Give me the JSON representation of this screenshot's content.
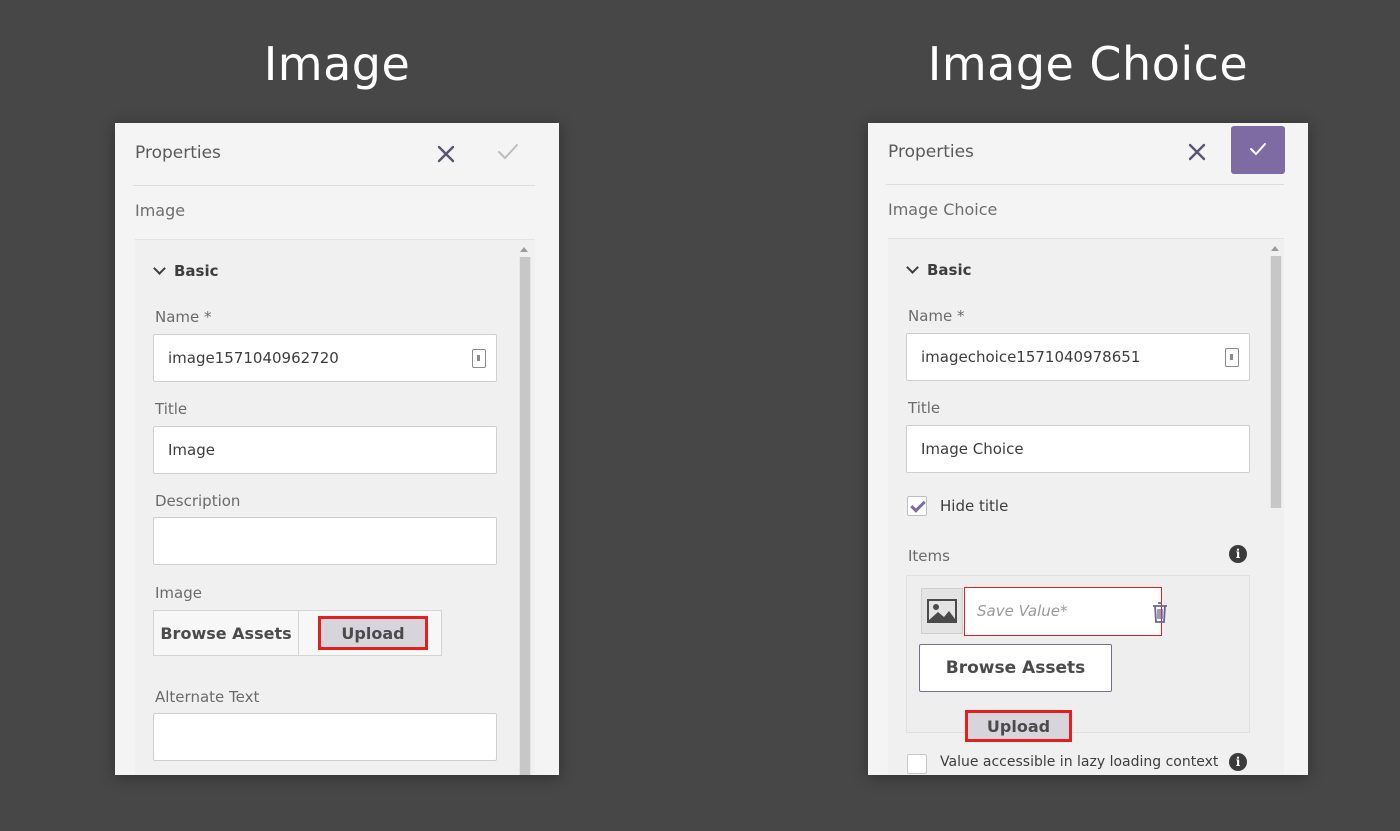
{
  "headings": {
    "left": "Image",
    "right": "Image Choice"
  },
  "left_panel": {
    "header_title": "Properties",
    "component_type": "Image",
    "section": "Basic",
    "name_label": "Name *",
    "name_value": "image1571040962720",
    "title_label": "Title",
    "title_value": "Image",
    "description_label": "Description",
    "description_value": "",
    "image_label": "Image",
    "browse_label": "Browse Assets",
    "upload_label": "Upload",
    "alt_text_label": "Alternate Text",
    "alt_text_value": ""
  },
  "right_panel": {
    "header_title": "Properties",
    "component_type": "Image Choice",
    "section": "Basic",
    "name_label": "Name *",
    "name_value": "imagechoice1571040978651",
    "title_label": "Title",
    "title_value": "Image Choice",
    "hide_title_label": "Hide title",
    "hide_title_checked": true,
    "items_label": "Items",
    "save_value_placeholder": "Save Value*",
    "browse_label": "Browse Assets",
    "upload_label": "Upload",
    "lazy_label": "Value accessible in lazy loading context",
    "lazy_checked": false
  },
  "colors": {
    "accent": "#7e6ba3",
    "highlight": "#e2201f",
    "background": "#474747"
  }
}
